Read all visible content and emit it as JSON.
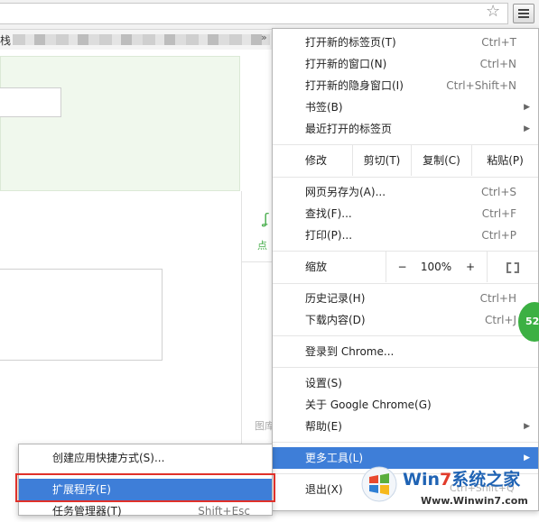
{
  "bookmarks_bar": {
    "leading_char": "栈"
  },
  "page": {
    "side_text_1": "点",
    "side_text_2": "图库"
  },
  "menu": {
    "new_tab": {
      "label": "打开新的标签页(T)",
      "shortcut": "Ctrl+T"
    },
    "new_window": {
      "label": "打开新的窗口(N)",
      "shortcut": "Ctrl+N"
    },
    "incognito": {
      "label": "打开新的隐身窗口(I)",
      "shortcut": "Ctrl+Shift+N"
    },
    "bookmarks": {
      "label": "书签(B)"
    },
    "recent_tabs": {
      "label": "最近打开的标签页"
    },
    "edit": {
      "label": "修改",
      "cut": "剪切(T)",
      "copy": "复制(C)",
      "paste": "粘贴(P)"
    },
    "save_as": {
      "label": "网页另存为(A)...",
      "shortcut": "Ctrl+S"
    },
    "find": {
      "label": "查找(F)...",
      "shortcut": "Ctrl+F"
    },
    "print": {
      "label": "打印(P)...",
      "shortcut": "Ctrl+P"
    },
    "zoom": {
      "label": "缩放",
      "minus": "−",
      "value": "100%",
      "plus": "+"
    },
    "history": {
      "label": "历史记录(H)",
      "shortcut": "Ctrl+H"
    },
    "downloads": {
      "label": "下载内容(D)",
      "shortcut": "Ctrl+J"
    },
    "signin": {
      "label": "登录到 Chrome..."
    },
    "settings": {
      "label": "设置(S)"
    },
    "about": {
      "label": "关于 Google Chrome(G)"
    },
    "help": {
      "label": "帮助(E)"
    },
    "more_tools": {
      "label": "更多工具(L)"
    },
    "exit": {
      "label": "退出(X)"
    }
  },
  "submenu": {
    "create_shortcut": {
      "label": "创建应用快捷方式(S)..."
    },
    "extensions": {
      "label": "扩展程序(E)"
    },
    "task_manager": {
      "label": "任务管理器(T)",
      "shortcut": "Shift+Esc"
    }
  },
  "badge": {
    "text": "52"
  },
  "watermark": {
    "shortcut_text": "Ctrl+Shift+Q",
    "title_a": "Win",
    "title_b": "7",
    "title_c": "系统之家",
    "url": "Www.Winwin7.com"
  },
  "colors": {
    "highlight": "#3e7ed8",
    "outline": "#e0312a"
  }
}
